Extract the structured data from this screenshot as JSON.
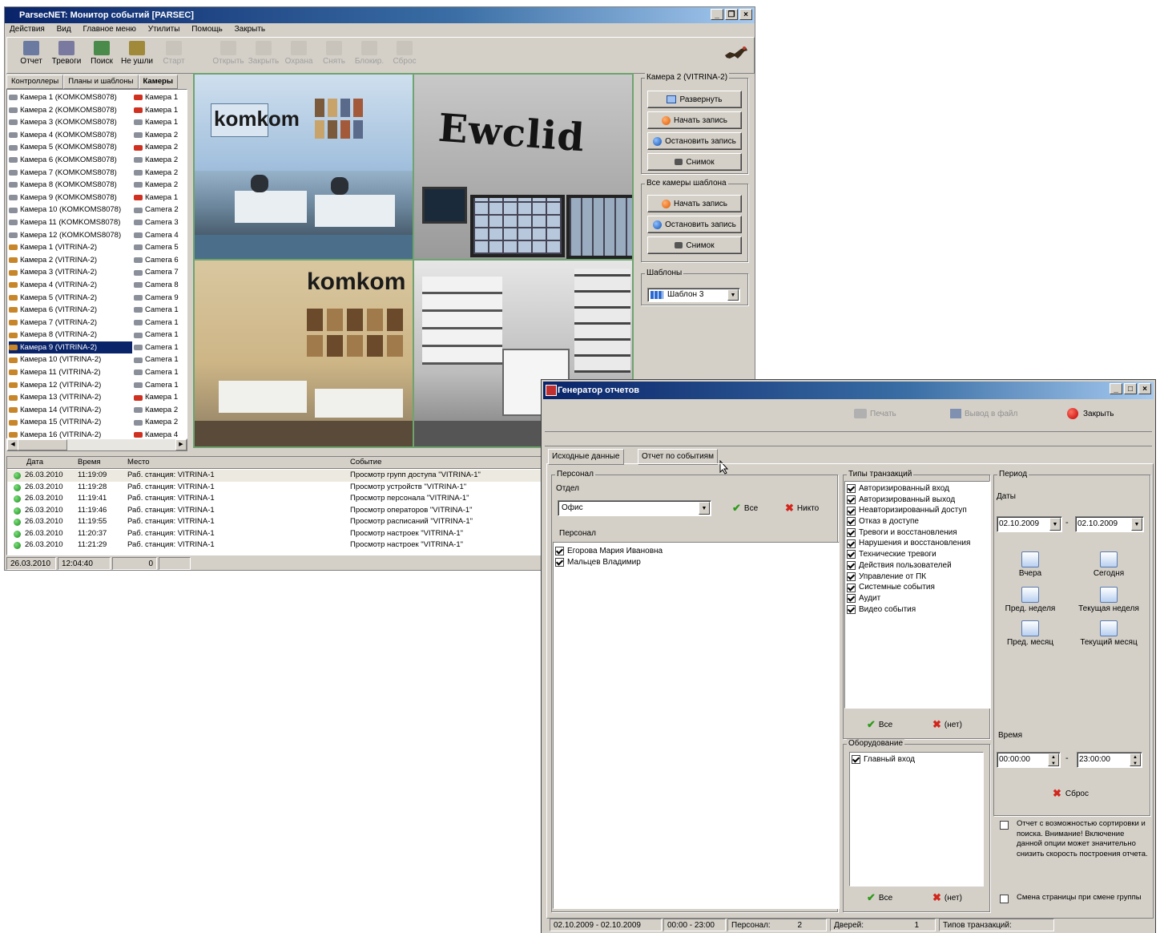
{
  "main_window": {
    "title": "ParsecNET: Монитор событий [PARSEC]",
    "menu": [
      "Действия",
      "Вид",
      "Главное меню",
      "Утилиты",
      "Помощь",
      "Закрыть"
    ],
    "toolbar": [
      {
        "label": "Отчет",
        "icon": "report-icon",
        "enabled": true
      },
      {
        "label": "Тревоги",
        "icon": "alarm-icon",
        "enabled": true
      },
      {
        "label": "Поиск",
        "icon": "search-person-icon",
        "enabled": true
      },
      {
        "label": "Не ушли",
        "icon": "not-left-icon",
        "enabled": true
      },
      {
        "label": "Старт",
        "icon": "start-icon",
        "enabled": false
      },
      {
        "label": "Открыть",
        "icon": "door-open-icon",
        "enabled": false
      },
      {
        "label": "Закрыть",
        "icon": "door-close-icon",
        "enabled": false
      },
      {
        "label": "Охрана",
        "icon": "guard-icon",
        "enabled": false
      },
      {
        "label": "Снять",
        "icon": "disarm-icon",
        "enabled": false
      },
      {
        "label": "Блокир.",
        "icon": "block-icon",
        "enabled": false
      },
      {
        "label": "Сброс",
        "icon": "reset-icon",
        "enabled": false
      }
    ],
    "tabs": [
      "Контроллеры",
      "Планы и шаблоны",
      "Камеры"
    ],
    "cameras_left": [
      "Камера 1 (KOMKOMS8078)",
      "Камера 2 (KOMKOMS8078)",
      "Камера 3 (KOMKOMS8078)",
      "Камера 4 (KOMKOMS8078)",
      "Камера 5 (KOMKOMS8078)",
      "Камера 6 (KOMKOMS8078)",
      "Камера 7 (KOMKOMS8078)",
      "Камера 8 (KOMKOMS8078)",
      "Камера 9 (KOMKOMS8078)",
      "Камера 10 (KOMKOMS8078)",
      "Камера 11 (KOMKOMS8078)",
      "Камера 12 (KOMKOMS8078)",
      "Камера 1 (VITRINA-2)",
      "Камера 2 (VITRINA-2)",
      "Камера 3 (VITRINA-2)",
      "Камера 4 (VITRINA-2)",
      "Камера 5 (VITRINA-2)",
      "Камера 6 (VITRINA-2)",
      "Камера 7 (VITRINA-2)",
      "Камера 8 (VITRINA-2)",
      "Камера 9 (VITRINA-2)",
      "Камера 10 (VITRINA-2)",
      "Камера 11 (VITRINA-2)",
      "Камера 12 (VITRINA-2)",
      "Камера 13 (VITRINA-2)",
      "Камера 14 (VITRINA-2)",
      "Камера 15 (VITRINA-2)",
      "Камера 16 (VITRINA-2)"
    ],
    "cameras_right": [
      "Камера 1",
      "Камера 1",
      "Камера 1",
      "Камера 2",
      "Камера 2",
      "Камера 2",
      "Камера 2",
      "Камера 2",
      "Камера 1",
      "Camera 2",
      "Camera 3",
      "Camera 4",
      "Camera 5",
      "Camera 6",
      "Camera 7",
      "Camera 8",
      "Camera 9",
      "Camera 1",
      "Camera 1",
      "Camera 1",
      "Camera 1",
      "Camera 1",
      "Camera 1",
      "Camera 1",
      "Камера 1",
      "Камера 2",
      "Камера 2",
      "Камера 4"
    ],
    "selected_camera_index": 20,
    "camera_panel": {
      "title": "Камера 2 (VITRINA-2)",
      "expand": "Развернуть",
      "start_rec": "Начать запись",
      "stop_rec": "Остановить запись",
      "snapshot": "Снимок",
      "all_title": "Все камеры шаблона",
      "all_start_rec": "Начать запись",
      "all_stop_rec": "Остановить запись",
      "all_snapshot": "Снимок",
      "templates_title": "Шаблоны",
      "template_value": "Шаблон 3"
    },
    "video_texts": {
      "komkom": "komkom",
      "ewclid": "Ewclid",
      "komkom2": "komkom"
    },
    "events_headers": [
      "Дата",
      "Время",
      "Место",
      "Событие"
    ],
    "events": [
      {
        "date": "26.03.2010",
        "time": "11:19:09",
        "place": "Раб. станция: VITRINA-1",
        "event": "Просмотр групп доступа \"VITRINA-1\""
      },
      {
        "date": "26.03.2010",
        "time": "11:19:28",
        "place": "Раб. станция: VITRINA-1",
        "event": "Просмотр устройств \"VITRINA-1\""
      },
      {
        "date": "26.03.2010",
        "time": "11:19:41",
        "place": "Раб. станция: VITRINA-1",
        "event": "Просмотр персонала \"VITRINA-1\""
      },
      {
        "date": "26.03.2010",
        "time": "11:19:46",
        "place": "Раб. станция: VITRINA-1",
        "event": "Просмотр операторов \"VITRINA-1\""
      },
      {
        "date": "26.03.2010",
        "time": "11:19:55",
        "place": "Раб. станция: VITRINA-1",
        "event": "Просмотр расписаний \"VITRINA-1\""
      },
      {
        "date": "26.03.2010",
        "time": "11:20:37",
        "place": "Раб. станция: VITRINA-1",
        "event": "Просмотр настроек \"VITRINA-1\""
      },
      {
        "date": "26.03.2010",
        "time": "11:21:29",
        "place": "Раб. станция: VITRINA-1",
        "event": "Просмотр настроек \"VITRINA-1\""
      }
    ],
    "status": {
      "date": "26.03.2010",
      "time": "12:04:40",
      "count": "0"
    }
  },
  "report_window": {
    "title": "Генератор отчетов",
    "print": "Печать",
    "export": "Вывод в файл",
    "close": "Закрыть",
    "tabs": [
      "Исходные данные",
      "Отчет по событиям"
    ],
    "personnel_group": "Персонал",
    "dept_label": "Отдел",
    "dept_value": "Офис",
    "all": "Все",
    "none": "Никто",
    "personnel_label": "Персонал",
    "people": [
      "Егорова Мария Ивановна",
      "Мальцев Владимир"
    ],
    "types_group": "Типы транзакций",
    "types": [
      "Авторизированный вход",
      "Авторизированный выход",
      "Неавторизированный доступ",
      "Отказ в доступе",
      "Тревоги и восстановления",
      "Нарушения и восстановления",
      "Технические тревоги",
      "Действия пользователей",
      "Управление от ПК",
      "Системные события",
      "Аудит",
      "Видео события"
    ],
    "types_all": "Все",
    "types_none": "(нет)",
    "equipment_group": "Оборудование",
    "equipment": [
      "Главный вход"
    ],
    "equip_all": "Все",
    "equip_none": "(нет)",
    "period_group": "Период",
    "dates_label": "Даты",
    "date_from": "02.10.2009",
    "date_to": "02.10.2009",
    "dash": "-",
    "yesterday": "Вчера",
    "today": "Сегодня",
    "prev_week": "Пред. неделя",
    "cur_week": "Текущая неделя",
    "prev_month": "Пред. месяц",
    "cur_month": "Текущий месяц",
    "time_label": "Время",
    "time_from": "00:00:00",
    "time_to": "23:00:00",
    "reset": "Сброс",
    "opt1": "Отчет с возможностью сортировки и поиска. Внимание! Включение данной опции может значительно снизить скорость построения отчета.",
    "opt2": "Смена страницы при смене группы",
    "status": {
      "dates": "02.10.2009 - 02.10.2009",
      "times": "00:00 - 23:00",
      "personnel_label": "Персонал:",
      "personnel_count": "2",
      "doors_label": "Дверей:",
      "doors_count": "1",
      "types_label": "Типов транзакций:"
    }
  }
}
